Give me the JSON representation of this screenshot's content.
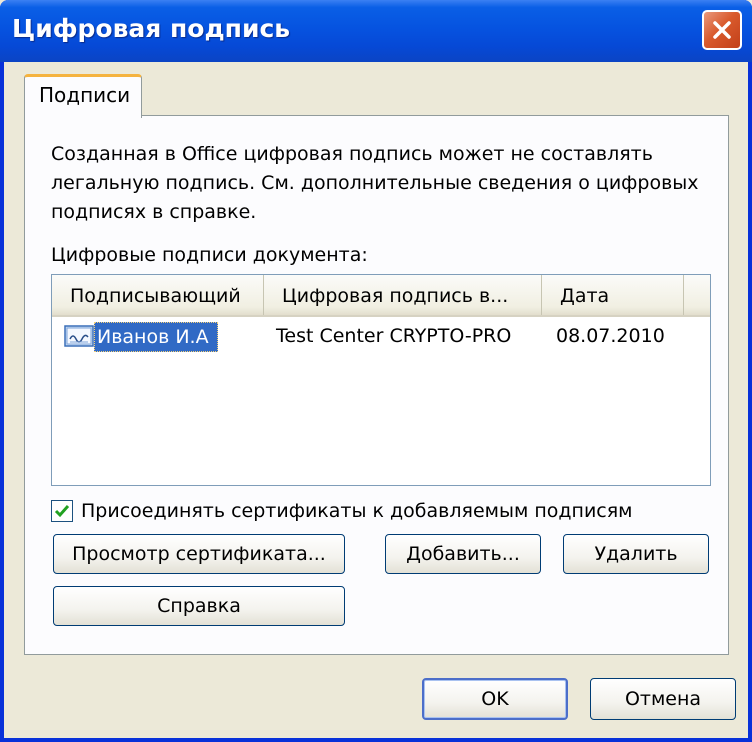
{
  "window": {
    "title": "Цифровая подпись"
  },
  "tabs": [
    {
      "label": "Подписи"
    }
  ],
  "description": "Созданная в Office цифровая подпись может не составлять легальную подпись. См. дополнительные сведения о цифровых подписях в справке.",
  "list_label": "Цифровые подписи документа:",
  "list": {
    "columns": [
      "Подписывающий",
      "Цифровая подпись в...",
      "Дата"
    ],
    "rows": [
      {
        "signer": "Иванов И.А",
        "issuer": "Test Center CRYPTO-PRO",
        "date": "08.07.2010",
        "icon": "signature-certificate-icon"
      }
    ]
  },
  "attach_certs": {
    "label": "Присоединять сертификаты к добавляемым подписям",
    "checked": true
  },
  "buttons": {
    "view_cert": "Просмотр сертификата...",
    "add": "Добавить...",
    "remove": "Удалить",
    "help": "Справка",
    "ok": "OK",
    "cancel": "Отмена"
  },
  "colors": {
    "accent": "#0653e0",
    "selection": "#316ac5",
    "close": "#d95a2c"
  }
}
